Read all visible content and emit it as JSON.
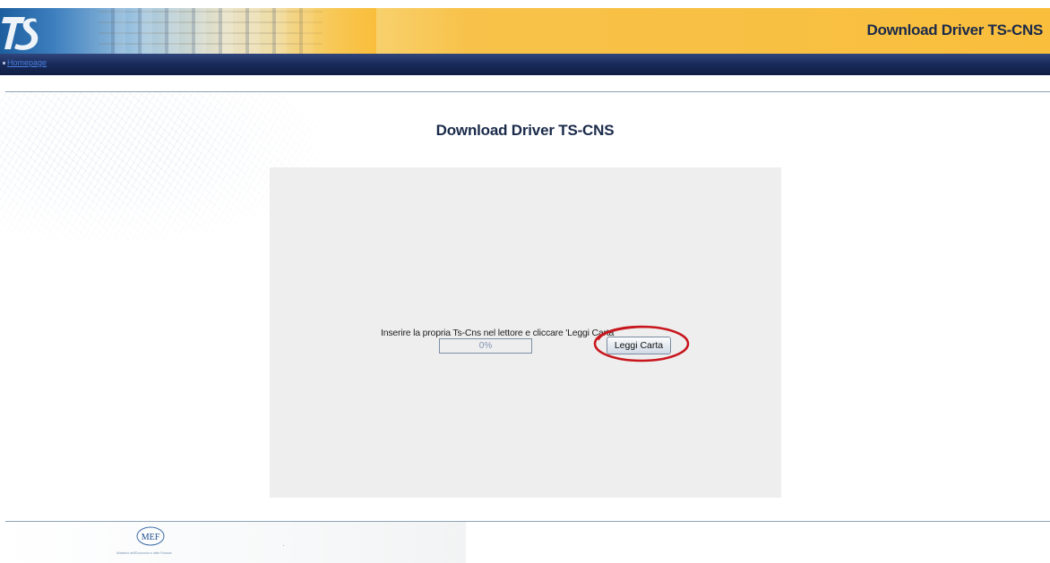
{
  "header": {
    "title": "Download Driver TS-CNS",
    "logo_text": "TS",
    "nav_link": "Homepage"
  },
  "main": {
    "page_title": "Download Driver TS-CNS",
    "instruction": "Inserire la propria Ts-Cns nel lettore e cliccare 'Leggi Carta'",
    "progress": {
      "value": 0,
      "label": "0%"
    },
    "read_button_label": "Leggi Carta",
    "highlight_color": "#c8161d"
  },
  "footer": {
    "logo_text": "MEF",
    "ministry_text": "Ministero dell'Economia e delle Finanze"
  },
  "colors": {
    "header_gold": "#f9be3c",
    "navbar": "#1a2c5c",
    "title_text": "#1a2a4a",
    "panel": "#eeeeee"
  }
}
